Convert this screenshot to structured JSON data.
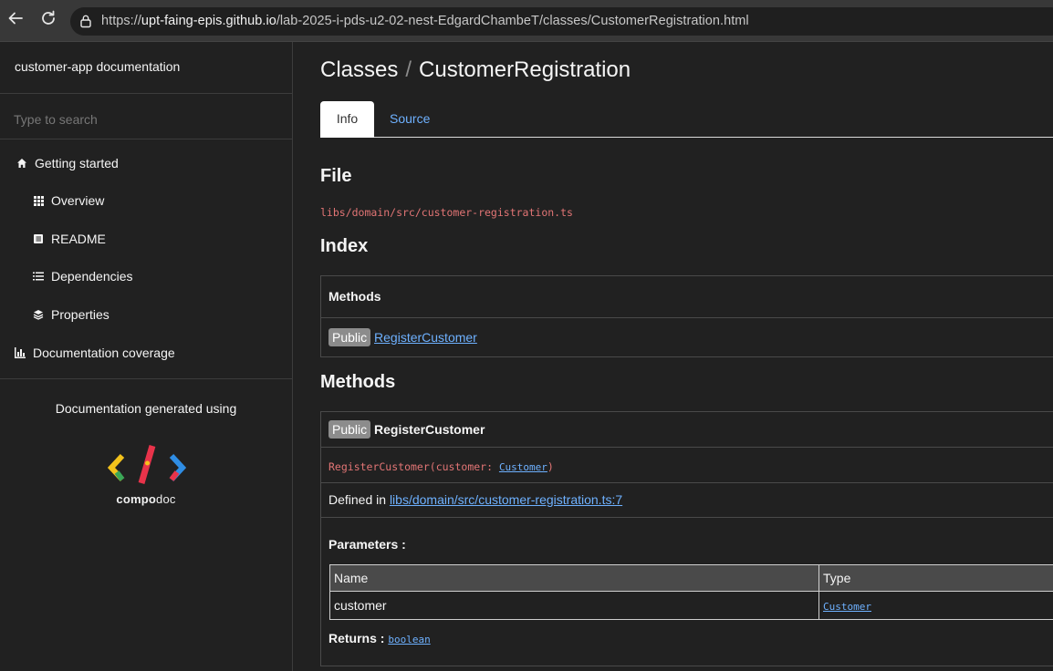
{
  "browser": {
    "url_scheme": "https://",
    "url_host": "upt-faing-epis.github.io",
    "url_path": "/lab-2025-i-pds-u2-02-nest-EdgardChambeT/classes/CustomerRegistration.html",
    "back_icon": "back-arrow-icon",
    "reload_icon": "reload-icon",
    "lock_icon": "lock-icon"
  },
  "sidebar": {
    "title": "customer-app documentation",
    "search_placeholder": "Type to search",
    "items": [
      {
        "label": "Getting started",
        "icon": "home-icon"
      },
      {
        "label": "Overview",
        "icon": "grid-icon"
      },
      {
        "label": "README",
        "icon": "book-icon"
      },
      {
        "label": "Dependencies",
        "icon": "list-icon"
      },
      {
        "label": "Properties",
        "icon": "layers-icon"
      },
      {
        "label": "Documentation coverage",
        "icon": "bar-chart-icon"
      }
    ],
    "generated_text": "Documentation generated using",
    "logo_text_bold": "compo",
    "logo_text_rest": "doc"
  },
  "main": {
    "breadcrumb_parent": "Classes",
    "breadcrumb_separator": "/",
    "breadcrumb_current": "CustomerRegistration",
    "tabs": [
      {
        "label": "Info",
        "active": true
      },
      {
        "label": "Source",
        "active": false
      }
    ],
    "file_heading": "File",
    "file_path": "libs/domain/src/customer-registration.ts",
    "index_heading": "Index",
    "index_methods_header": "Methods",
    "index_badge": "Public",
    "index_method_link": "RegisterCustomer",
    "methods_heading": "Methods",
    "method": {
      "badge": "Public",
      "name": "RegisterCustomer",
      "signature_prefix": "RegisterCustomer(customer: ",
      "signature_type": "Customer",
      "signature_suffix": ")",
      "defined_in_label": "Defined in ",
      "defined_in_link": "libs/domain/src/customer-registration.ts:7",
      "parameters_label": "Parameters :",
      "param_columns": [
        "Name",
        "Type"
      ],
      "params": [
        {
          "name": "customer",
          "type": "Customer"
        }
      ],
      "returns_label": "Returns : ",
      "returns_type": "boolean"
    }
  },
  "colors": {
    "background": "#212121",
    "link": "#6eb1ff",
    "code": "#e27575",
    "badge": "#8c8c8c"
  }
}
